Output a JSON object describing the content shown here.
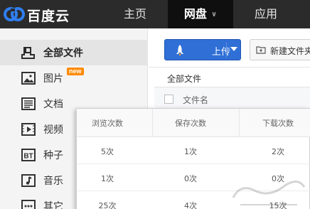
{
  "brand": {
    "name": "百度云",
    "accent": "#2f6fd6",
    "topbar_bg": "#2b2b2b"
  },
  "nav": {
    "home": "主页",
    "disk": "网盘",
    "app": "应用"
  },
  "sidebar": {
    "items": [
      {
        "label": "全部文件",
        "icon": "all-files-icon"
      },
      {
        "label": "图片",
        "icon": "image-icon",
        "badge": "new"
      },
      {
        "label": "文档",
        "icon": "document-icon"
      },
      {
        "label": "视频",
        "icon": "video-icon"
      },
      {
        "label": "种子",
        "icon": "bt-icon"
      },
      {
        "label": "音乐",
        "icon": "music-icon"
      },
      {
        "label": "其它",
        "icon": "other-icon"
      }
    ]
  },
  "toolbar": {
    "upload_label": "上传",
    "new_folder_label": "新建文件夹"
  },
  "breadcrumb": "全部文件",
  "list": {
    "name_header": "文件名"
  },
  "stats": {
    "headers": [
      "浏览次数",
      "保存次数",
      "下载次数"
    ],
    "rows": [
      [
        "5次",
        "1次",
        "2次"
      ],
      [
        "1次",
        "0次",
        "0次"
      ],
      [
        "25次",
        "4次",
        "15次"
      ]
    ]
  }
}
